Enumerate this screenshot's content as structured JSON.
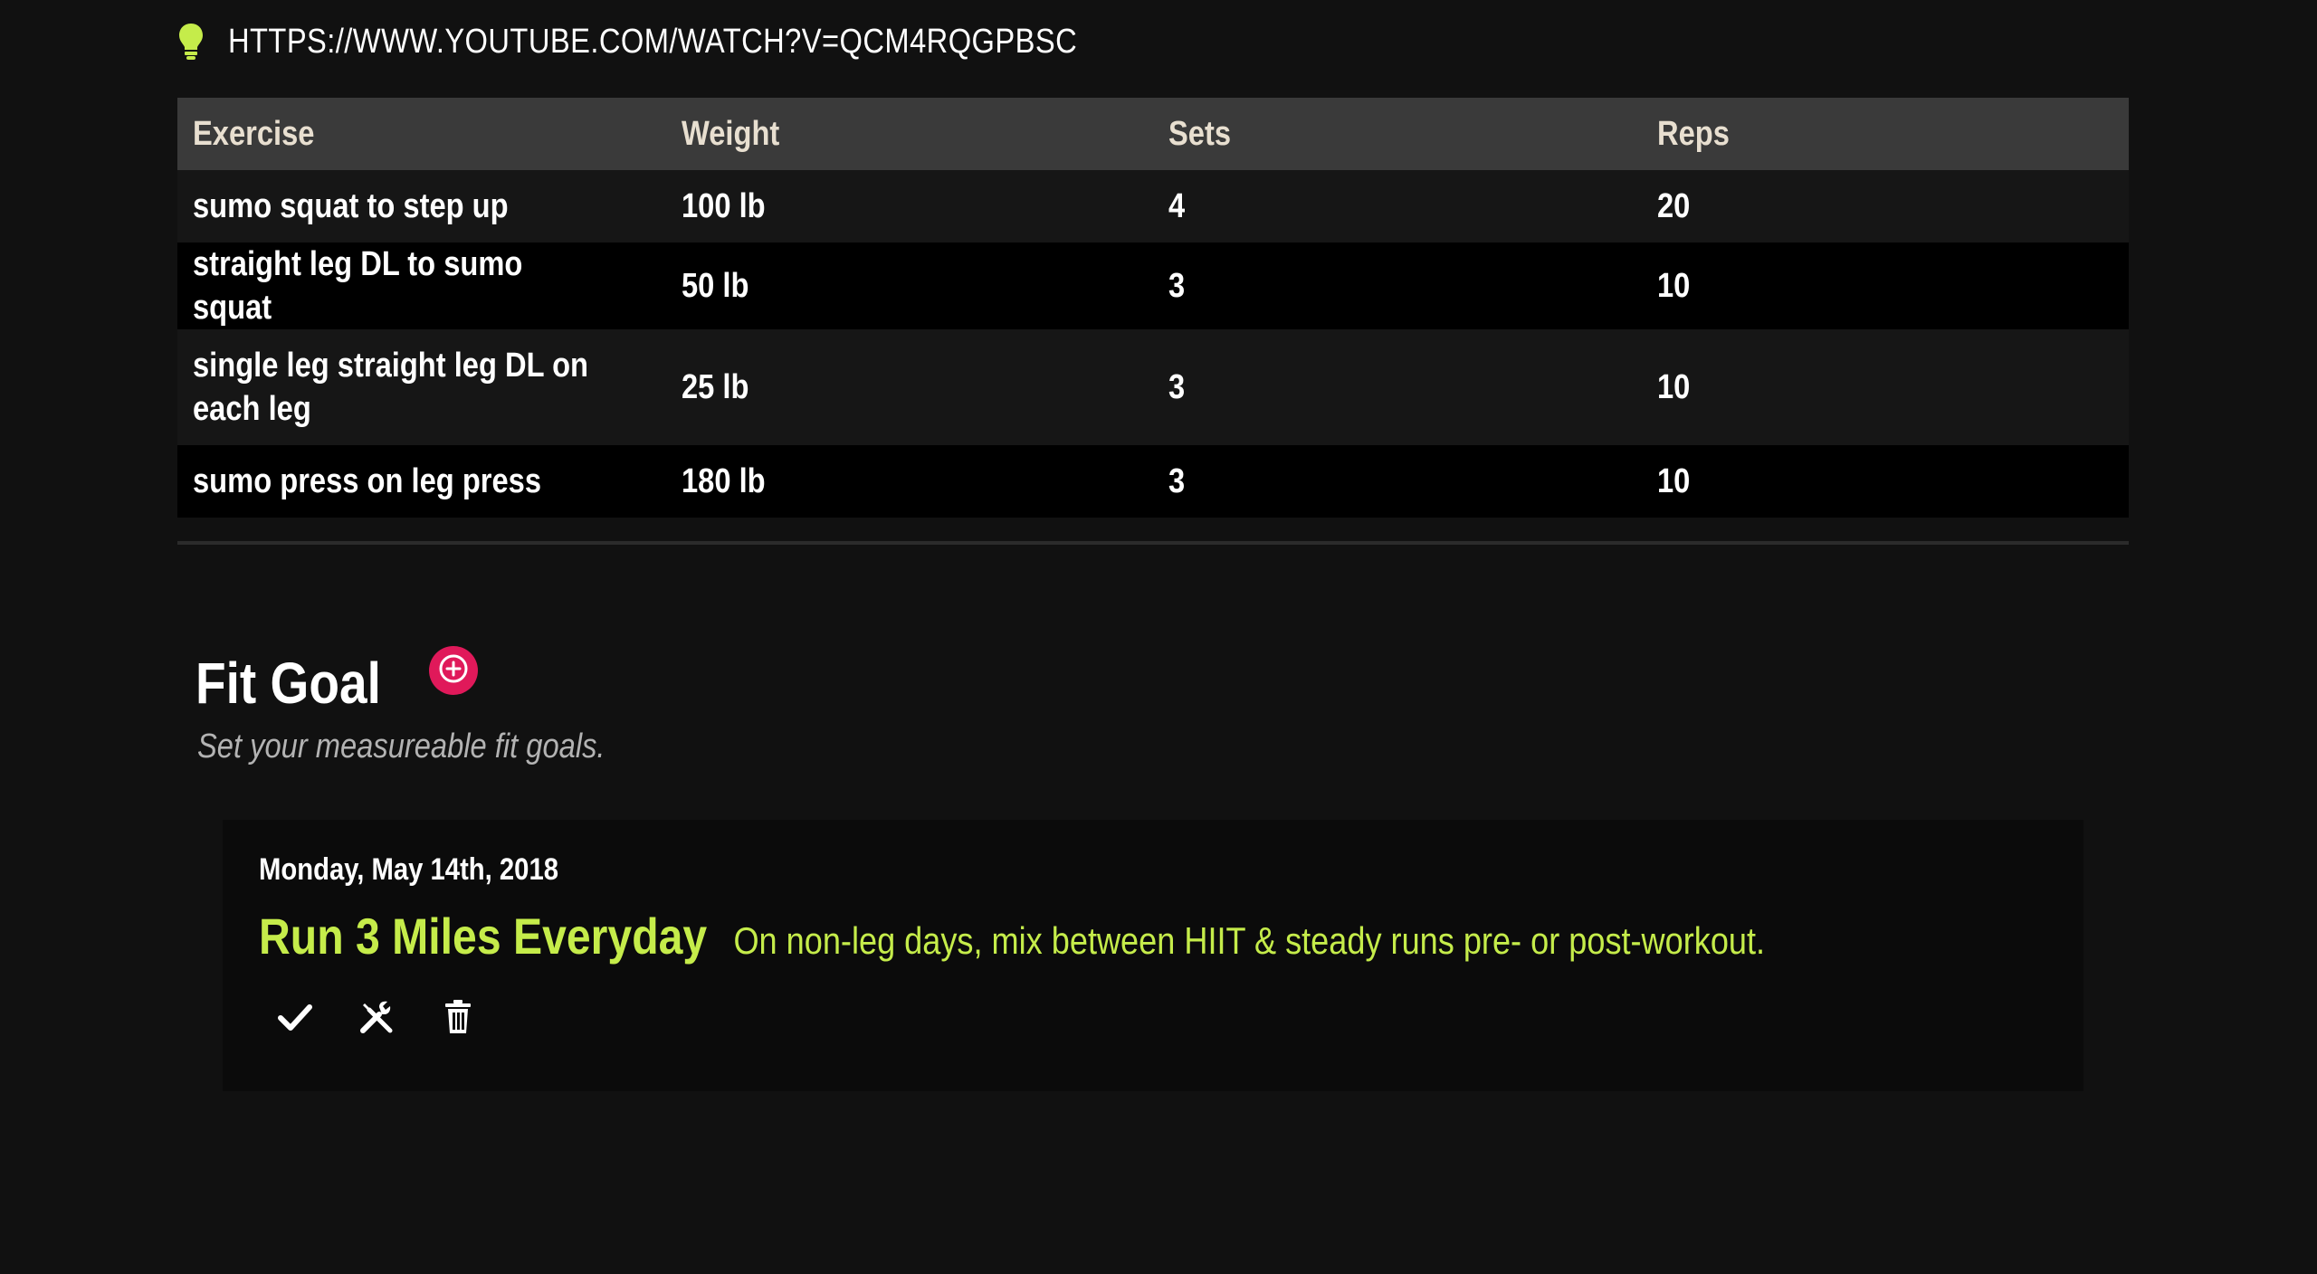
{
  "video_link": {
    "icon": "lightbulb-icon",
    "url_text": "HTTPS://WWW.YOUTUBE.COM/WATCH?V=QCM4RQGPBSC"
  },
  "table": {
    "headers": [
      "Exercise",
      "Weight",
      "Sets",
      "Reps"
    ],
    "rows": [
      {
        "exercise": "sumo squat to step up",
        "weight": "100 lb",
        "sets": "4",
        "reps": "20"
      },
      {
        "exercise": "straight leg DL to sumo squat",
        "weight": "50 lb",
        "sets": "3",
        "reps": "10"
      },
      {
        "exercise": "single leg straight leg DL on each leg",
        "weight": "25 lb",
        "sets": "3",
        "reps": "10"
      },
      {
        "exercise": "sumo press on leg press",
        "weight": "180 lb",
        "sets": "3",
        "reps": "10"
      }
    ]
  },
  "fit_goal": {
    "title": "Fit Goal",
    "subtitle": "Set your measureable fit goals.",
    "add_icon": "plus-circle-icon",
    "goals": [
      {
        "date": "Monday, May 14th, 2018",
        "name": "Run 3 Miles Everyday",
        "description": "On non-leg days, mix between HIIT & steady runs pre- or post-workout.",
        "actions": [
          "check-icon",
          "tools-icon",
          "trash-icon"
        ]
      }
    ]
  },
  "colors": {
    "accent_green": "#c5ec4a",
    "accent_pink": "#e0195a",
    "background": "#111111",
    "header_bg": "#3a3a3a",
    "header_text": "#e8dfd0"
  }
}
